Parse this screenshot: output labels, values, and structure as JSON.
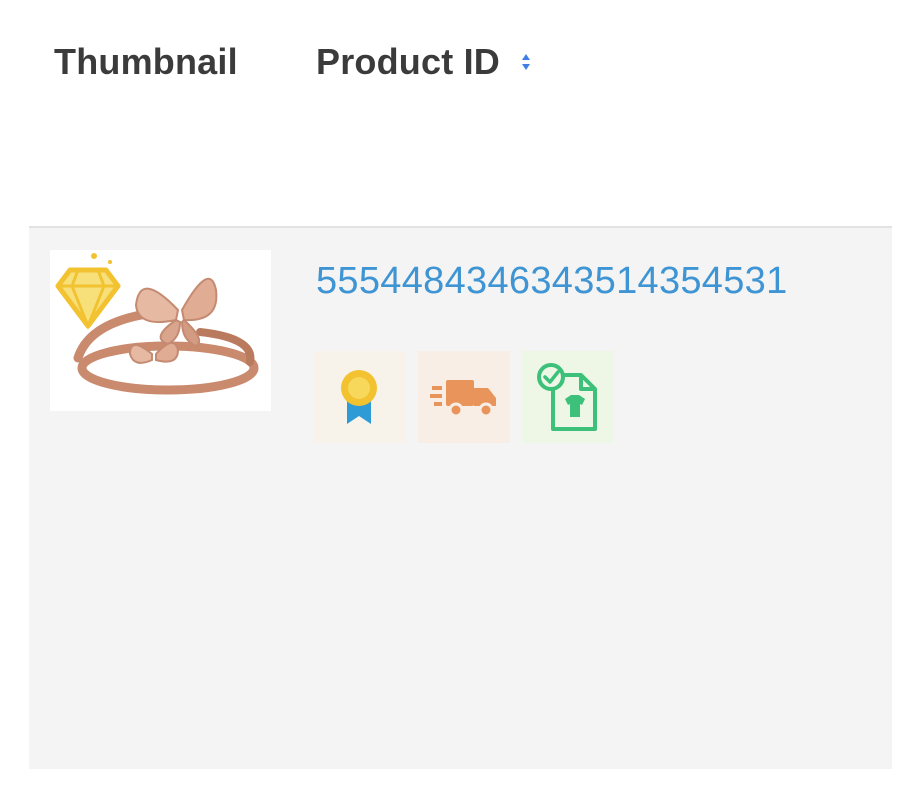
{
  "table": {
    "columns": {
      "thumbnail": "Thumbnail",
      "product_id": "Product ID"
    },
    "rows": [
      {
        "product_id": "5554484346343514354531",
        "thumbnail_icon": "butterfly-ring-image",
        "badges": [
          "award-ribbon-icon",
          "fast-shipping-truck-icon",
          "verified-product-doc-icon"
        ]
      }
    ]
  },
  "colors": {
    "link": "#3f95d3",
    "header_text": "#3b3b3b",
    "row_bg": "#f4f4f4",
    "sort_icon": "#3f7fe8",
    "award": "#f2c230",
    "shipping": "#e8945a",
    "doc": "#3cc07a"
  }
}
